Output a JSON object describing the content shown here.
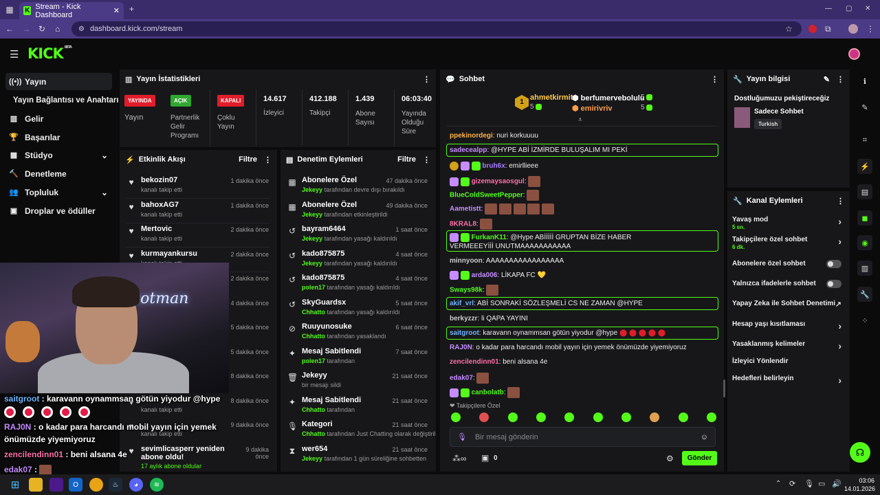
{
  "browser": {
    "tab_title": "Stream - Kick Dashboard",
    "url": "dashboard.kick.com/stream"
  },
  "brand": {
    "logo": "KICK",
    "beta": "BETA",
    "accent": "#53fc18"
  },
  "sidebar": {
    "items": [
      {
        "label": "Yayın",
        "icon": "broadcast-icon"
      },
      {
        "label": "Yayın Bağlantısı ve Anahtarı",
        "icon": ""
      },
      {
        "label": "Gelir",
        "icon": "revenue-icon"
      },
      {
        "label": "Başarılar",
        "icon": "trophy-icon"
      },
      {
        "label": "Stüdyo",
        "icon": "studio-icon"
      },
      {
        "label": "Denetleme",
        "icon": "moderation-icon"
      },
      {
        "label": "Topluluk",
        "icon": "community-icon"
      },
      {
        "label": "Droplar ve ödüller",
        "icon": "drops-icon"
      }
    ]
  },
  "stats": {
    "title": "Yayın İstatistikleri",
    "items": [
      {
        "badge": "YAYINDA",
        "label": "Yayın",
        "color": "#e11d2a"
      },
      {
        "badge": "AÇIK",
        "label": "Partnerlik Gelir Programı",
        "color": "#2fa82f"
      },
      {
        "badge": "KAPALI",
        "label": "Çoklu Yayın",
        "color": "#e11d2a"
      },
      {
        "value": "14.617",
        "label": "İzleyici"
      },
      {
        "value": "412.188",
        "label": "Takipçi"
      },
      {
        "value": "1.439",
        "label": "Abone Sayısı"
      },
      {
        "value": "06:03:40",
        "label": "Yayında Olduğu Süre"
      }
    ]
  },
  "activity": {
    "title": "Etkinlik Akışı",
    "filter": "Filtre",
    "rows": [
      {
        "name": "bekozin07",
        "sub": "kanalı takip etti",
        "time": "1 dakika önce"
      },
      {
        "name": "bahoxAG7",
        "sub": "kanalı takip etti",
        "time": "1 dakika önce"
      },
      {
        "name": "Mertovic",
        "sub": "kanalı takip etti",
        "time": "2 dakika önce"
      },
      {
        "name": "kurmayankursu",
        "sub": "kanalı takip etti",
        "time": "2 dakika önce"
      },
      {
        "name": "",
        "sub": "",
        "time": "2 dakika önce"
      },
      {
        "name": "",
        "sub": "",
        "time": "4 dakika önce"
      },
      {
        "name": "",
        "sub": "",
        "time": "5 dakika önce"
      },
      {
        "name": "",
        "sub": "",
        "time": "5 dakika önce"
      },
      {
        "name": "",
        "sub": "",
        "time": "8 dakika önce"
      },
      {
        "name": "",
        "sub": "kanalı takip etti",
        "time": "8 dakika önce"
      },
      {
        "name": "",
        "sub": "kanalı takip etti",
        "time": "9 dakika önce"
      },
      {
        "name": "sevimlicasperr yeniden abone oldu!",
        "sub": "17 aylık abone oldular",
        "time": "9 dakika önce"
      }
    ]
  },
  "moderation": {
    "title": "Denetim Eylemleri",
    "filter": "Filtre",
    "rows": [
      {
        "name": "Abonelere Özel",
        "mod": "Jekeyy",
        "action": "tarafından devre dışı bırakıldı",
        "time": "47 dakika önce",
        "icon": "gift-icon"
      },
      {
        "name": "Abonelere Özel",
        "mod": "Jekeyy",
        "action": "tarafından etkinleştirildi",
        "time": "49 dakika önce",
        "icon": "gift-icon"
      },
      {
        "name": "bayram6464",
        "mod": "Jekeyy",
        "action": "tarafından yasağı kaldırıldı",
        "time": "1 saat önce",
        "icon": "undo-icon"
      },
      {
        "name": "kado875875",
        "mod": "Jekeyy",
        "action": "tarafından yasağı kaldırıldı",
        "time": "4 saat önce",
        "icon": "undo-icon"
      },
      {
        "name": "kado875875",
        "mod": "polen17",
        "action": "tarafından yasağı kaldırıldı",
        "time": "4 saat önce",
        "icon": "undo-icon"
      },
      {
        "name": "SkyGuardsx",
        "mod": "Chhatto",
        "action": "tarafından yasağı kaldırıldı",
        "time": "5 saat önce",
        "icon": "undo-icon"
      },
      {
        "name": "Ruuyunosuke",
        "mod": "Chhatto",
        "action": "tarafından yasaklandı",
        "time": "6 saat önce",
        "icon": "ban-icon"
      },
      {
        "name": "Mesaj Sabitlendi",
        "mod": "polen17",
        "action": "tarafından",
        "time": "7 saat önce",
        "icon": "pin-icon"
      },
      {
        "name": "Jekeyy",
        "mod": "",
        "action": "bir mesajı sildi",
        "time": "21 saat önce",
        "icon": "trash-icon"
      },
      {
        "name": "Mesaj Sabitlendi",
        "mod": "Chhatto",
        "action": "tarafından",
        "time": "21 saat önce",
        "icon": "pin-icon"
      },
      {
        "name": "Kategori",
        "mod": "Chhatto",
        "action": "tarafından Just Chatting olarak değiştirildi",
        "time": "21 saat önce",
        "icon": "mic-icon"
      },
      {
        "name": "wer654",
        "mod": "Jekeyy",
        "action": "tarafından 1 gün süreliğine sohbetten",
        "time": "21 saat önce",
        "icon": "hourglass-icon"
      }
    ]
  },
  "chat": {
    "title": "Sohbet",
    "top": [
      {
        "name": "ahmetkirmit",
        "count": "5",
        "rank": "1"
      },
      {
        "name": "berfumervebolulu",
        "count": "5"
      },
      {
        "name": "emirivriv",
        "count": "5"
      }
    ],
    "messages": [
      {
        "user": "ppekinordegi",
        "color": "#ffb347",
        "text": "nuri korkuuuu",
        "highlight": false
      },
      {
        "user": "sadecealpp",
        "color": "#c58cff",
        "text": "@HYPE ABİ İZMİRDE BULUŞALIM MI PEKİ",
        "highlight": true
      },
      {
        "user": "bruh6x",
        "color": "#a77cff",
        "text": "emirllieee",
        "highlight": false
      },
      {
        "user": "gizemaysaosgul",
        "color": "#ff6fa8",
        "text": "",
        "highlight": false
      },
      {
        "user": "BlueColdSweetPepper",
        "color": "#53fc18",
        "text": "",
        "highlight": false
      },
      {
        "user": "Aametistt",
        "color": "#c58cff",
        "text": "",
        "highlight": false
      },
      {
        "user": "8KRAL8",
        "color": "#ff6fa8",
        "text": "",
        "highlight": false
      },
      {
        "user": "FurkanK11",
        "color": "#53fc18",
        "text": "@Hype ABİİİİİ GRUPTAN BİZE HABER VERMEEEYİİİ UNUTMAAAAAAAAAAA",
        "highlight": true
      },
      {
        "user": "minnyoon",
        "color": "#cccccc",
        "text": "AAAAAAAAAAAAAAAAA",
        "highlight": false
      },
      {
        "user": "arda006",
        "color": "#c58cff",
        "text": "LİKAPA FC 💛",
        "highlight": false
      },
      {
        "user": "Sways98k",
        "color": "#53fc18",
        "text": "",
        "highlight": false
      },
      {
        "user": "akif_vrl",
        "color": "#6fb3ff",
        "text": "ABİ SONRAKİ SÖZLEŞMELİ CS NE ZAMAN @HYPE",
        "highlight": true
      },
      {
        "user": "berkyzzr",
        "color": "#cccccc",
        "text": "li QAPA YAYINI",
        "highlight": false
      },
      {
        "user": "saitgroot",
        "color": "#6fb3ff",
        "text": "karavann oynammsan götün yiyodur @hype",
        "highlight": true
      },
      {
        "user": "RAJ0N",
        "color": "#c58cff",
        "text": "o kadar para harcandı mobil yayın için yemek önümüzde yiyemiyoruz",
        "highlight": false
      },
      {
        "user": "zencilendinn01",
        "color": "#ff6fa8",
        "text": "beni alsana 4e",
        "highlight": false
      },
      {
        "user": "edak07",
        "color": "#c58cff",
        "text": "",
        "highlight": false
      },
      {
        "user": "canbolatb",
        "color": "#53fc18",
        "text": "",
        "highlight": false
      }
    ],
    "emote_label": "Takipçilere Özel",
    "input_placeholder": "Bir mesaj gönderin",
    "send": "Gönder",
    "footer_count": "0"
  },
  "stream_info": {
    "title": "Yayın bilgisi",
    "stream_title": "Dostluğumuzu pekiştireceğiz",
    "category": "Sadece Sohbet",
    "tag": "Turkish"
  },
  "channel_actions": {
    "title": "Kanal Eylemleri",
    "items": [
      {
        "label": "Yavaş mod",
        "sub": "5 sn.",
        "type": "chevron"
      },
      {
        "label": "Takipçilere özel sohbet",
        "sub": "6 dk.",
        "type": "chevron"
      },
      {
        "label": "Abonelere özel sohbet",
        "sub": "",
        "type": "toggle"
      },
      {
        "label": "Yalnızca ifadelerle sohbet",
        "sub": "",
        "type": "toggle"
      },
      {
        "label": "Yapay Zeka ile Sohbet Denetimi",
        "sub": "",
        "type": "external"
      },
      {
        "label": "Hesap yaşı kısıtlaması",
        "sub": "",
        "type": "chevron"
      },
      {
        "label": "Yasaklanmış kelimeler",
        "sub": "",
        "type": "chevron"
      },
      {
        "label": "İzleyici Yönlendir",
        "sub": "",
        "type": "none"
      },
      {
        "label": "Hedefleri belirleyin",
        "sub": "",
        "type": "chevron"
      }
    ]
  },
  "overlay": {
    "lines": [
      {
        "user": "saitgroot",
        "text": " : karavann oynammsan götün yiyodur @hype",
        "color": "#6fb3ff"
      },
      {
        "user": "RAJ0N",
        "text": " : o kadar para harcandı mobil yayın için yemek",
        "color": "#c58cff"
      },
      {
        "user": "",
        "text": "önümüzde yiyemiyoruz",
        "color": "#ffffff"
      },
      {
        "user": "zencilendinn01",
        "text": " : beni alsana 4e",
        "color": "#ff6fa8"
      },
      {
        "user": "edak07",
        "text": " :",
        "color": "#c58cff"
      }
    ],
    "neon": "hotman"
  },
  "taskbar": {
    "time": "03:06",
    "date": "14.01.2026"
  }
}
